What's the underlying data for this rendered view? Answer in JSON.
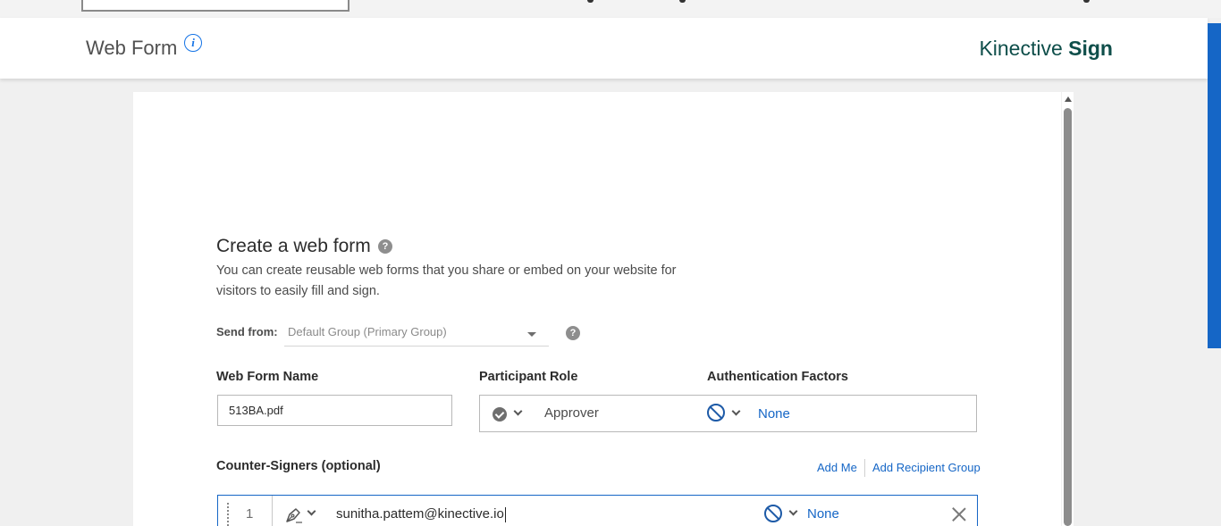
{
  "header": {
    "title": "Web Form",
    "brand_light": "Kinective",
    "brand_bold": "Sign"
  },
  "form": {
    "heading": "Create a web form",
    "description": "You can create reusable web forms that you share or embed on your website for visitors to easily fill and sign.",
    "send_from_label": "Send from:",
    "send_from_value": "Default Group (Primary Group)",
    "web_form_name_label": "Web Form Name",
    "web_form_name_value": "513BA.pdf",
    "participant_role_label": "Participant Role",
    "participant_role_value": "Approver",
    "auth_factors_label": "Authentication Factors",
    "auth_factors_value": "None",
    "counter_signers_label": "Counter-Signers (optional)",
    "add_me": "Add Me",
    "add_recipient_group": "Add Recipient Group"
  },
  "signers": [
    {
      "index": "1",
      "email": "sunitha.pattem@kinective.io",
      "auth": "None"
    }
  ],
  "colors": {
    "accent": "#1566c6",
    "brand": "#0e4e4a"
  }
}
